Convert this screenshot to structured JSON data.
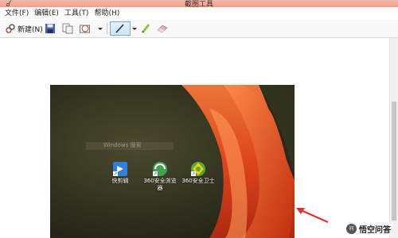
{
  "window": {
    "title": "截图工具"
  },
  "menu": {
    "items": [
      "文件(F)",
      "编辑(E)",
      "工具(T)",
      "帮助(H)"
    ]
  },
  "toolbar": {
    "new_label": "新建(N)"
  },
  "desktop": {
    "search_text": "Windows 搜索",
    "icons": [
      {
        "label": "快剪辑",
        "icon": "kuaijianji-icon"
      },
      {
        "label": "360安全浏览器",
        "icon": "360-browser-icon"
      },
      {
        "label": "360安全卫士",
        "icon": "360-security-icon"
      }
    ]
  },
  "watermark": {
    "text": "悟空问答"
  },
  "colors": {
    "titlebar": "#efa08c",
    "pen_active": "#cfe3f6",
    "arrow": "#e03131",
    "petal": "#e8451c"
  }
}
